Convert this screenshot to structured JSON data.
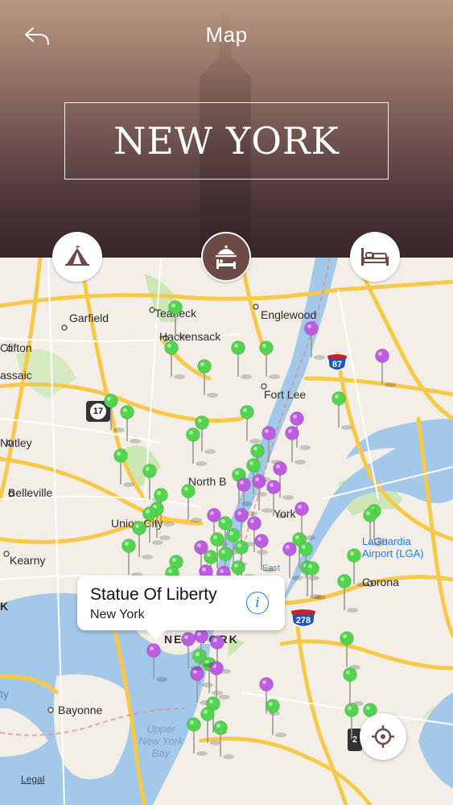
{
  "header": {
    "title": "Map",
    "city": "NEW YORK",
    "back_icon": "back-arrow-icon"
  },
  "categories": [
    {
      "name": "attractions",
      "icon": "tent-icon",
      "selected": false
    },
    {
      "name": "hotels",
      "icon": "hotel-bell-icon",
      "selected": true
    },
    {
      "name": "accommodation",
      "icon": "bed-icon",
      "selected": false
    }
  ],
  "map": {
    "labels": {
      "teaneck": "Teaneck",
      "garfield": "Garfield",
      "englewood": "Englewood",
      "hackensack": "Hackensack",
      "clifton": "Clifton",
      "passaic": "assaic",
      "fort_lee": "Fort Lee",
      "nutley": "Nutley",
      "north_bergen": "North B",
      "belleville": "Belleville",
      "union_city": "Union City",
      "new_york_partial": "York",
      "laguardia": "LaGuardia\nAirport (LGA)",
      "kearny": "Kearny",
      "corona": "Corona",
      "bayonne": "Bayonne",
      "upper_bay": "Upper\nNew York\nBay",
      "manhattan": "NEW YORK",
      "east": "East",
      "edge_k": "K",
      "edge_y": "ty"
    },
    "shields": {
      "i87": "87",
      "i278": "278",
      "r17": "17",
      "partial": "2"
    },
    "pin_colors": {
      "attraction": "#52d44f",
      "hotel": "#bc5ce0"
    },
    "legal": "Legal",
    "locate_icon": "crosshair-icon"
  },
  "callout": {
    "title": "Statue Of Liberty",
    "subtitle": "New York",
    "info_icon": "info-icon"
  }
}
